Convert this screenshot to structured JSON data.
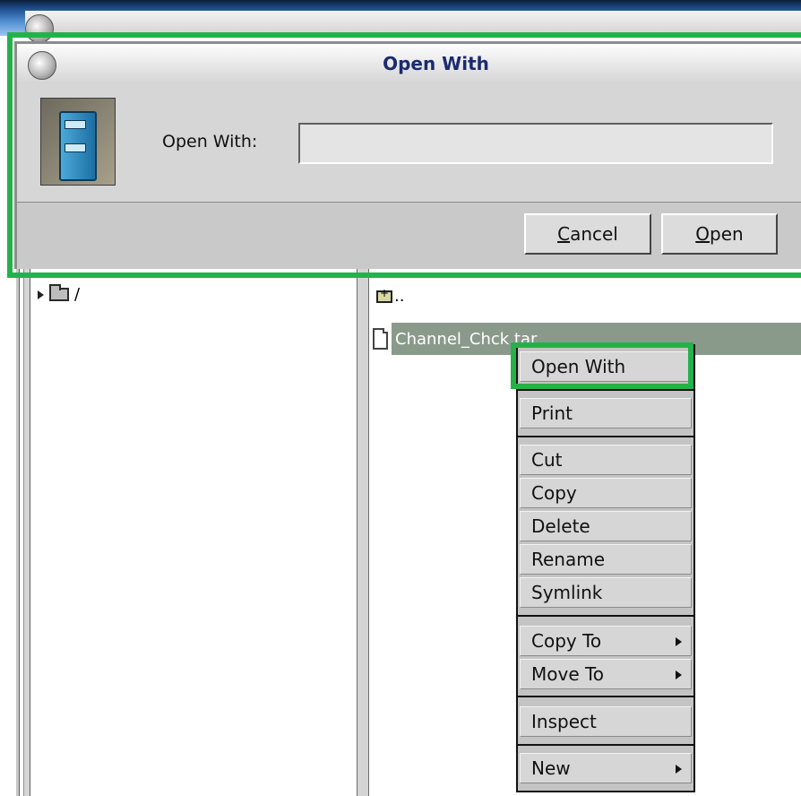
{
  "dialog": {
    "title": "Open With",
    "field_label": "Open With:",
    "field_value": "",
    "cancel_label": "Cancel",
    "open_label": "Open"
  },
  "file_manager": {
    "tree_root": "/",
    "parent_entry": "..",
    "selected_file": "Channel_Chck.tar"
  },
  "context_menu": {
    "items": [
      {
        "label": "Open With",
        "has_submenu": false
      },
      {
        "label": "Print",
        "has_submenu": false
      },
      {
        "label": "Cut",
        "has_submenu": false
      },
      {
        "label": "Copy",
        "has_submenu": false
      },
      {
        "label": "Delete",
        "has_submenu": false
      },
      {
        "label": "Rename",
        "has_submenu": false
      },
      {
        "label": "Symlink",
        "has_submenu": false
      },
      {
        "label": "Copy To",
        "has_submenu": true
      },
      {
        "label": "Move To",
        "has_submenu": true
      },
      {
        "label": "Inspect",
        "has_submenu": false
      },
      {
        "label": "New",
        "has_submenu": true
      }
    ]
  },
  "colors": {
    "highlight": "#23b24a",
    "selection": "#8a9a8a",
    "title_text": "#1b2b6e"
  },
  "icons": [
    "window-menu-icon",
    "file-cabinet-icon",
    "folder-icon",
    "parent-folder-icon",
    "file-icon",
    "submenu-arrow-icon",
    "expand-triangle-icon"
  ]
}
